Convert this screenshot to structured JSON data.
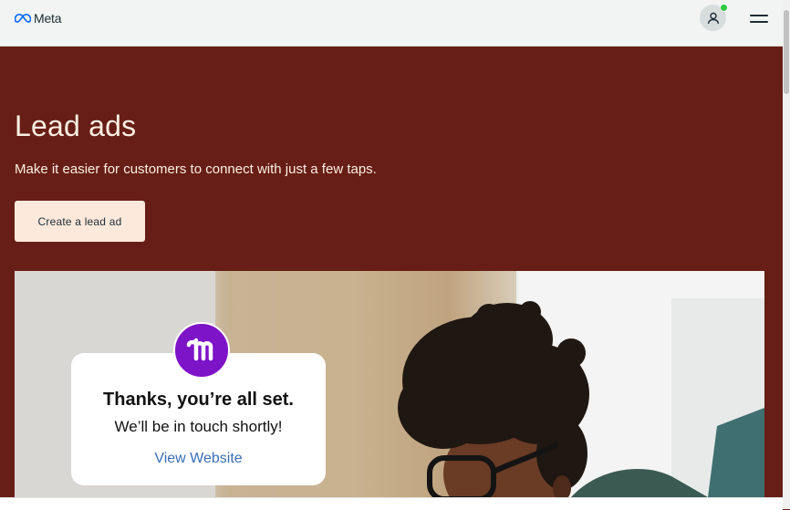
{
  "header": {
    "logo_text": "Meta",
    "logo_icon": "meta-infinity-icon",
    "account_icon": "person-icon",
    "menu_icon": "hamburger-icon",
    "online_status_color": "#31c940"
  },
  "hero": {
    "title": "Lead ads",
    "subtitle": "Make it easier for customers to connect with just a few taps.",
    "cta_label": "Create a lead ad",
    "background_color": "#671e16",
    "text_color": "#fbefe3",
    "cta_color": "#fde9dc"
  },
  "card": {
    "badge_icon": "brand-m-icon",
    "badge_color": "#7d14c8",
    "title": "Thanks, you’re all set.",
    "subtitle": "We’ll be in touch shortly!",
    "link": "View Website",
    "link_color": "#3a6fb5"
  }
}
